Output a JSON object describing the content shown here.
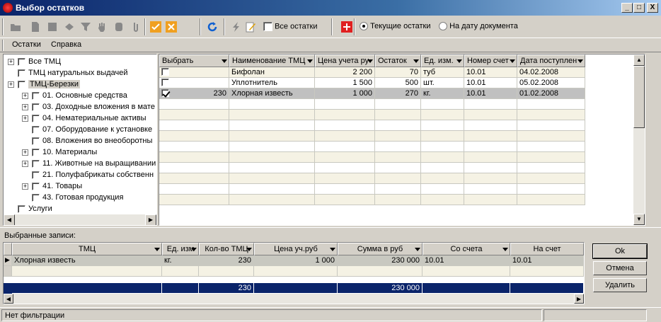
{
  "window": {
    "title": "Выбор остатков",
    "min": "_",
    "max": "□",
    "close": "X"
  },
  "toolbar": {
    "all_remainders": "Все остатки",
    "current_remainders": "Текущие остатки",
    "on_date": "На дату документа"
  },
  "menu": {
    "remainders": "Остатки",
    "help": "Справка"
  },
  "tree": [
    {
      "label": "Все ТМЦ",
      "level": 0,
      "expand": true
    },
    {
      "label": "ТМЦ натуральных выдачей",
      "level": 0,
      "expand": false
    },
    {
      "label": "ТМЦ-Березки",
      "level": 0,
      "expand": true,
      "selected": true
    },
    {
      "label": "01. Основные средства",
      "level": 1,
      "expand": true
    },
    {
      "label": "03. Доходные вложения в мате",
      "level": 1,
      "expand": true
    },
    {
      "label": "04. Нематериальные активы",
      "level": 1,
      "expand": true
    },
    {
      "label": "07. Оборудование к установке",
      "level": 1,
      "expand": false
    },
    {
      "label": "08. Вложения во внеоборотны",
      "level": 1,
      "expand": false
    },
    {
      "label": "10. Материалы",
      "level": 1,
      "expand": true
    },
    {
      "label": "11. Животные на выращивании",
      "level": 1,
      "expand": true
    },
    {
      "label": "21. Полуфабрикаты собственн",
      "level": 1,
      "expand": false
    },
    {
      "label": "41. Товары",
      "level": 1,
      "expand": true
    },
    {
      "label": "43. Готовая продукция",
      "level": 1,
      "expand": false
    },
    {
      "label": "Услуги",
      "level": 0,
      "expand": false
    }
  ],
  "grid": {
    "headers": [
      "Выбрать",
      "Наименование ТМЦ",
      "Цена учета ру",
      "Остаток",
      "Ед. изм.",
      "Номер счет",
      "Дата поступлен"
    ],
    "rows": [
      {
        "checked": false,
        "qty": "",
        "name": "Бифолан",
        "price": "2 200",
        "rest": "70",
        "unit": "туб",
        "acc": "10.01",
        "date": "04.02.2008"
      },
      {
        "checked": false,
        "qty": "",
        "name": "Уплотнитель",
        "price": "1 500",
        "rest": "500",
        "unit": "шт.",
        "acc": "10.01",
        "date": "05.02.2008"
      },
      {
        "checked": true,
        "qty": "230",
        "name": "Хлорная известь",
        "price": "1 000",
        "rest": "270",
        "unit": "кг.",
        "acc": "10.01",
        "date": "01.02.2008"
      }
    ]
  },
  "selected": {
    "label": "Выбранные записи:",
    "headers": [
      "ТМЦ",
      "Ед. изм",
      "Кол-во ТМЦ",
      "Цена уч.руб",
      "Сумма в руб",
      "Со счета",
      "На счет"
    ],
    "rows": [
      {
        "name": "Хлорная известь",
        "unit": "кг.",
        "qty": "230",
        "price": "1 000",
        "sum": "230 000",
        "from": "10.01",
        "to": "10.01"
      }
    ],
    "total": {
      "qty": "230",
      "sum": "230 000"
    }
  },
  "buttons": {
    "ok": "Ok",
    "cancel": "Отмена",
    "delete": "Удалить"
  },
  "status": {
    "filter": "Нет фильтрации"
  }
}
